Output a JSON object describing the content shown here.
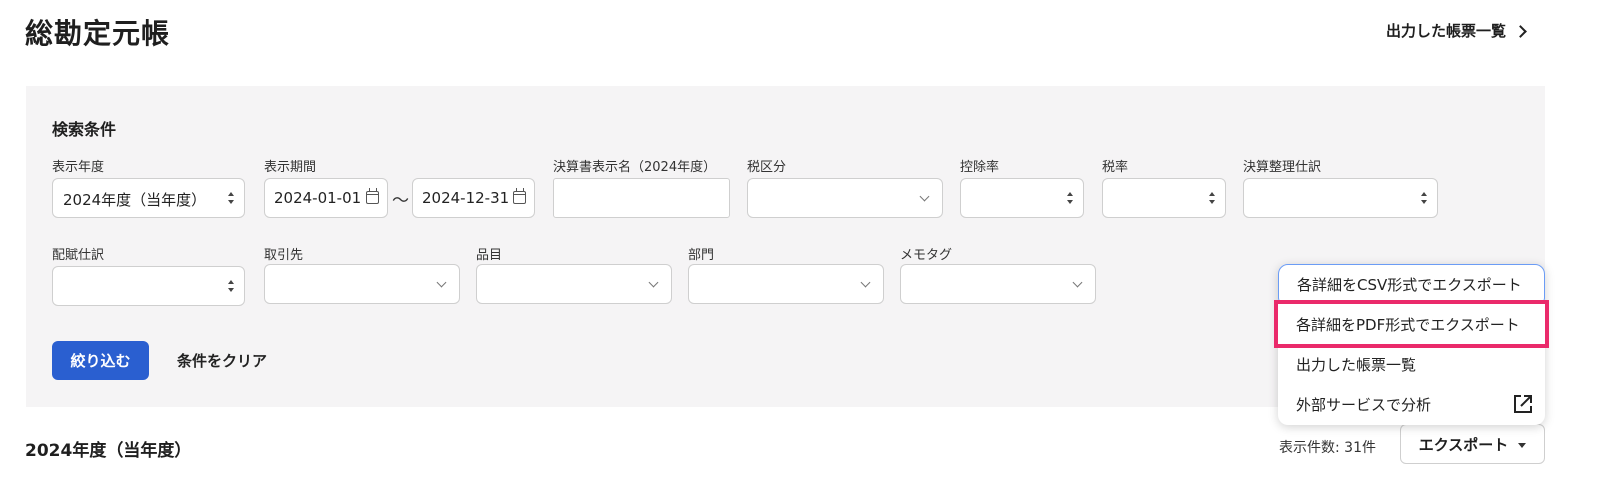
{
  "header": {
    "title": "総勘定元帳",
    "report_link": "出力した帳票一覧"
  },
  "search": {
    "title": "検索条件",
    "fields": {
      "fiscal_year": {
        "label": "表示年度",
        "value": "2024年度（当年度）"
      },
      "period": {
        "label": "表示期間",
        "start": "2024-01-01",
        "end": "2024-12-31",
        "separator": "〜"
      },
      "statement_name": {
        "label": "決算書表示名（2024年度）",
        "value": ""
      },
      "tax_category": {
        "label": "税区分",
        "value": ""
      },
      "deduction_rate": {
        "label": "控除率",
        "value": ""
      },
      "tax_rate": {
        "label": "税率",
        "value": ""
      },
      "closing_entry": {
        "label": "決算整理仕訳",
        "value": ""
      },
      "allocation_entry": {
        "label": "配賦仕訳",
        "value": ""
      },
      "partner": {
        "label": "取引先",
        "value": ""
      },
      "item": {
        "label": "品目",
        "value": ""
      },
      "department": {
        "label": "部門",
        "value": ""
      },
      "memo_tag": {
        "label": "メモタグ",
        "value": ""
      }
    },
    "apply_label": "絞り込む",
    "clear_label": "条件をクリア"
  },
  "results": {
    "section_title": "2024年度（当年度）",
    "count_text": "表示件数: 31件",
    "export_label": "エクスポート"
  },
  "export_menu": {
    "items": [
      {
        "label": "各詳細をCSV形式でエクスポート"
      },
      {
        "label": "各詳細をPDF形式でエクスポート"
      },
      {
        "label": "出力した帳票一覧"
      },
      {
        "label": "外部サービスで分析",
        "icon": "external-link-icon"
      }
    ]
  },
  "colors": {
    "primary": "#2a5fd0",
    "panel_bg": "#f5f4f5",
    "highlight": "#ea2a6b",
    "focus": "#6b9cf5"
  }
}
